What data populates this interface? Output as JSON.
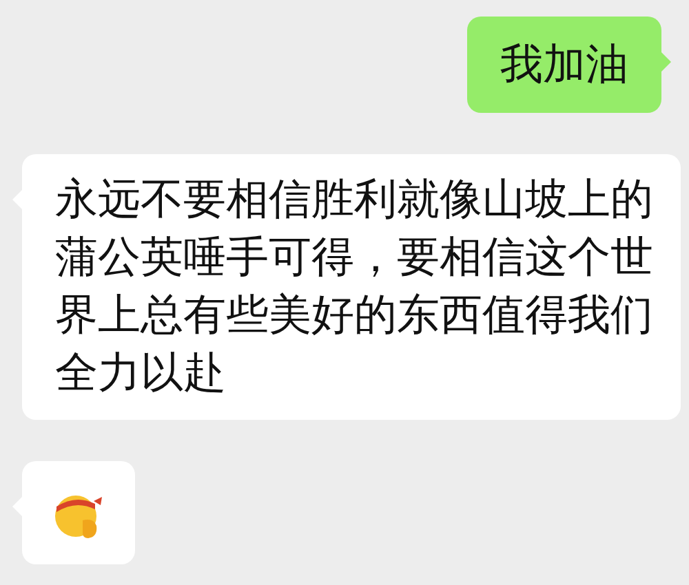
{
  "messages": [
    {
      "kind": "text",
      "outgoing": true,
      "text": "我加油"
    },
    {
      "kind": "text",
      "outgoing": false,
      "text": "永远不要相信胜利就像山坡上的蒲公英唾手可得，要相信这个世界上总有些美好的东西值得我们全力以赴"
    },
    {
      "kind": "sticker",
      "outgoing": false
    }
  ]
}
